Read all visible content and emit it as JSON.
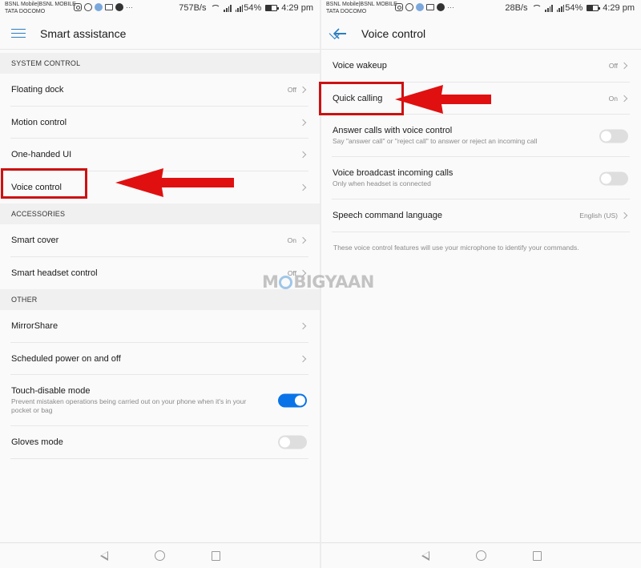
{
  "left": {
    "status": {
      "carrier_line1": "BSNL Mobile|BSNL MOBILE",
      "carrier_line2": "TATA DOCOMO",
      "speed": "757B/s",
      "battery": "54%",
      "battery_level": 0.54,
      "time": "4:29 pm"
    },
    "appbar": {
      "title": "Smart assistance",
      "nav_icon": "menu-icon"
    },
    "sections": [
      {
        "header": "SYSTEM CONTROL",
        "items": [
          {
            "label": "Floating dock",
            "value": "Off",
            "type": "chevron"
          },
          {
            "label": "Motion control",
            "value": "",
            "type": "chevron"
          },
          {
            "label": "One-handed UI",
            "value": "",
            "type": "chevron"
          },
          {
            "label": "Voice control",
            "value": "",
            "type": "chevron",
            "highlighted": true
          }
        ]
      },
      {
        "header": "ACCESSORIES",
        "items": [
          {
            "label": "Smart cover",
            "value": "On",
            "type": "chevron"
          },
          {
            "label": "Smart headset control",
            "value": "Off",
            "type": "chevron"
          }
        ]
      },
      {
        "header": "OTHER",
        "items": [
          {
            "label": "MirrorShare",
            "value": "",
            "type": "chevron"
          },
          {
            "label": "Scheduled power on and off",
            "value": "",
            "type": "chevron"
          },
          {
            "label": "Touch-disable mode",
            "sub": "Prevent mistaken operations being carried out on your phone when it's in your pocket or bag",
            "type": "toggle",
            "checked": true
          },
          {
            "label": "Gloves mode",
            "type": "toggle",
            "checked": false
          }
        ]
      }
    ]
  },
  "right": {
    "status": {
      "carrier_line1": "BSNL Mobile|BSNL MOBILE",
      "carrier_line2": "TATA DOCOMO",
      "speed": "28B/s",
      "battery": "54%",
      "battery_level": 0.54,
      "time": "4:29 pm"
    },
    "appbar": {
      "title": "Voice control",
      "nav_icon": "back-arrow-icon"
    },
    "items": [
      {
        "label": "Voice wakeup",
        "value": "Off",
        "type": "chevron"
      },
      {
        "label": "Quick calling",
        "value": "On",
        "type": "chevron",
        "highlighted": true
      },
      {
        "label": "Answer calls with voice control",
        "sub": "Say \"answer call\" or \"reject call\" to answer or reject an incoming call",
        "type": "toggle",
        "checked": false
      },
      {
        "label": "Voice broadcast incoming calls",
        "sub": "Only when headset is connected",
        "type": "toggle",
        "checked": false
      },
      {
        "label": "Speech command language",
        "value": "English (US)",
        "type": "chevron"
      }
    ],
    "note": "These voice control features will use your microphone to identify your commands."
  },
  "watermark": {
    "pre": "M",
    "post": "BIGYAAN"
  },
  "colors": {
    "accent": "#2a7ec2",
    "toggle_on": "#0a73e8",
    "annotation_red": "#cc1111"
  }
}
